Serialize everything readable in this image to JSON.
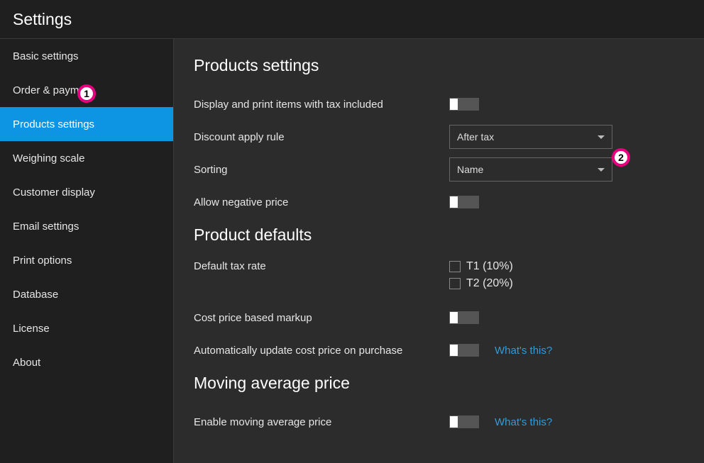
{
  "title": "Settings",
  "sidebar": {
    "items": [
      {
        "label": "Basic settings"
      },
      {
        "label": "Order & payment"
      },
      {
        "label": "Products settings"
      },
      {
        "label": "Weighing scale"
      },
      {
        "label": "Customer display"
      },
      {
        "label": "Email settings"
      },
      {
        "label": "Print options"
      },
      {
        "label": "Database"
      },
      {
        "label": "License"
      },
      {
        "label": "About"
      }
    ]
  },
  "main": {
    "section_products": "Products settings",
    "display_tax_label": "Display and print items with tax included",
    "discount_rule_label": "Discount apply rule",
    "discount_rule_value": "After tax",
    "sorting_label": "Sorting",
    "sorting_value": "Name",
    "allow_negative_label": "Allow negative price",
    "section_defaults": "Product defaults",
    "default_tax_label": "Default tax rate",
    "tax1_label": "T1 (10%)",
    "tax2_label": "T2 (20%)",
    "markup_label": "Cost price based markup",
    "auto_update_label": "Automatically update cost price on purchase",
    "whats_this": "What's this?",
    "section_moving": "Moving average price",
    "enable_moving_label": "Enable moving average price"
  },
  "callouts": {
    "c1": "1",
    "c2": "2"
  }
}
